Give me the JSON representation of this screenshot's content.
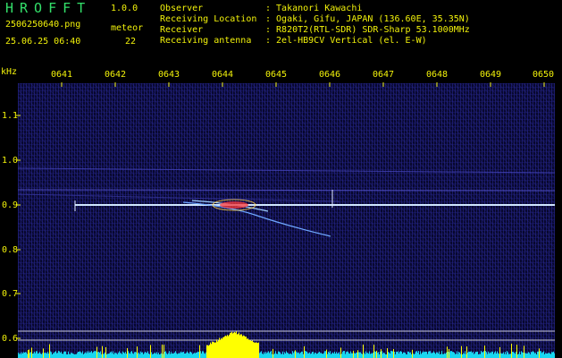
{
  "header": {
    "app_title": "HROFFT",
    "app_version": "1.0.0",
    "file_name": "2506250640.png",
    "meteor_label": "meteor",
    "obs_datetime": "25.06.25 06:40",
    "meteor_count": "22",
    "info": [
      {
        "label": "Observer",
        "value": ": Takanori Kawachi"
      },
      {
        "label": "Receiving Location",
        "value": ": Ogaki, Gifu, JAPAN (136.60E, 35.35N)"
      },
      {
        "label": "Receiver",
        "value": ": R820T2(RTL-SDR) SDR-Sharp 53.1000MHz"
      },
      {
        "label": "Receiving antenna",
        "value": ": 2el-HB9CV Vertical (el. E-W)"
      }
    ]
  },
  "axes": {
    "y_unit": "kHz",
    "x_ticks": [
      "0641",
      "0642",
      "0643",
      "0644",
      "0645",
      "0646",
      "0647",
      "0648",
      "0649",
      "0650"
    ],
    "y_ticks": [
      "1.1",
      "1.0",
      "0.9",
      "0.8",
      "0.7",
      "0.6"
    ]
  },
  "colors": {
    "background": "#000000",
    "header_green": "#33e06a",
    "label_yellow": "#f2f20a",
    "spectrogram_bg": "#08082e",
    "carrier_line": "#cfe6ff",
    "echo_hot": "#ff3c3c",
    "level_trace": "#ffff00",
    "noise_trace": "#19d7f0"
  }
}
